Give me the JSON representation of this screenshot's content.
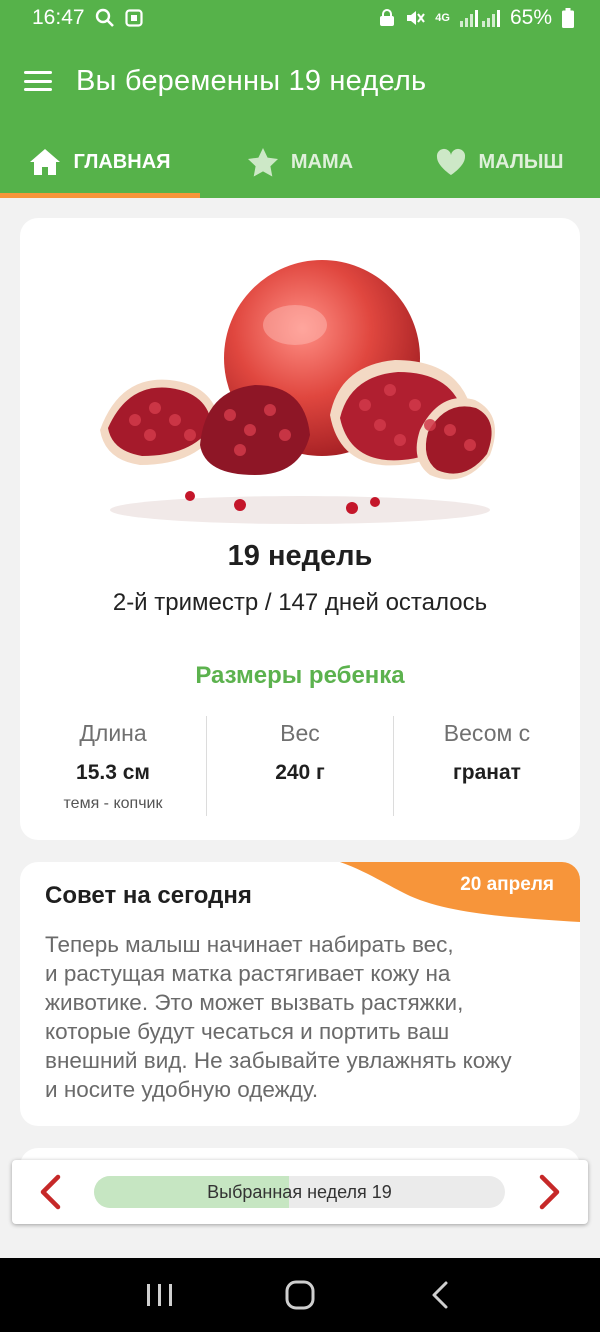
{
  "status": {
    "time": "16:47",
    "battery": "65%",
    "network": "4G",
    "icons": [
      "search-icon",
      "screenshot-icon",
      "lock-icon",
      "mute-icon",
      "signal-icon",
      "battery-icon"
    ]
  },
  "appbar": {
    "title": "Вы беременны 19 недель",
    "menu_icon": "hamburger-menu-icon"
  },
  "tabs": [
    {
      "label": "ГЛАВНАЯ",
      "icon": "home-icon",
      "active": true
    },
    {
      "label": "МАМА",
      "icon": "star-icon",
      "active": false
    },
    {
      "label": "МАЛЫШ",
      "icon": "heart-icon",
      "active": false
    }
  ],
  "summary": {
    "image": "pomegranate-image",
    "week_title": "19 недель",
    "subtitle": "2-й триместр / 147 дней осталось",
    "sizes_title": "Размеры ребенка",
    "stats": [
      {
        "label": "Длина",
        "value": "15.3 см",
        "note": "темя - копчик"
      },
      {
        "label": "Вес",
        "value": "240 г",
        "note": ""
      },
      {
        "label": "Весом с",
        "value": "гранат",
        "note": ""
      }
    ]
  },
  "tip": {
    "title": "Совет на сегодня",
    "date": "20 апреля",
    "lines": [
      "Теперь малыш начинает набирать вес,",
      "и растущая матка растягивает кожу на",
      "животике. Это может вызвать растяжки,",
      "которые будут чесаться и портить ваш",
      "внешний вид. Не забывайте увлажнять кожу",
      "и носите удобную одежду."
    ]
  },
  "week_selector": {
    "label": "Выбранная неделя 19",
    "progress_fraction": 0.475
  },
  "colors": {
    "brand_green": "#56b24a",
    "accent_orange": "#f7953a",
    "arrow_red": "#c62828",
    "progress_fill": "#c6e6c2"
  }
}
